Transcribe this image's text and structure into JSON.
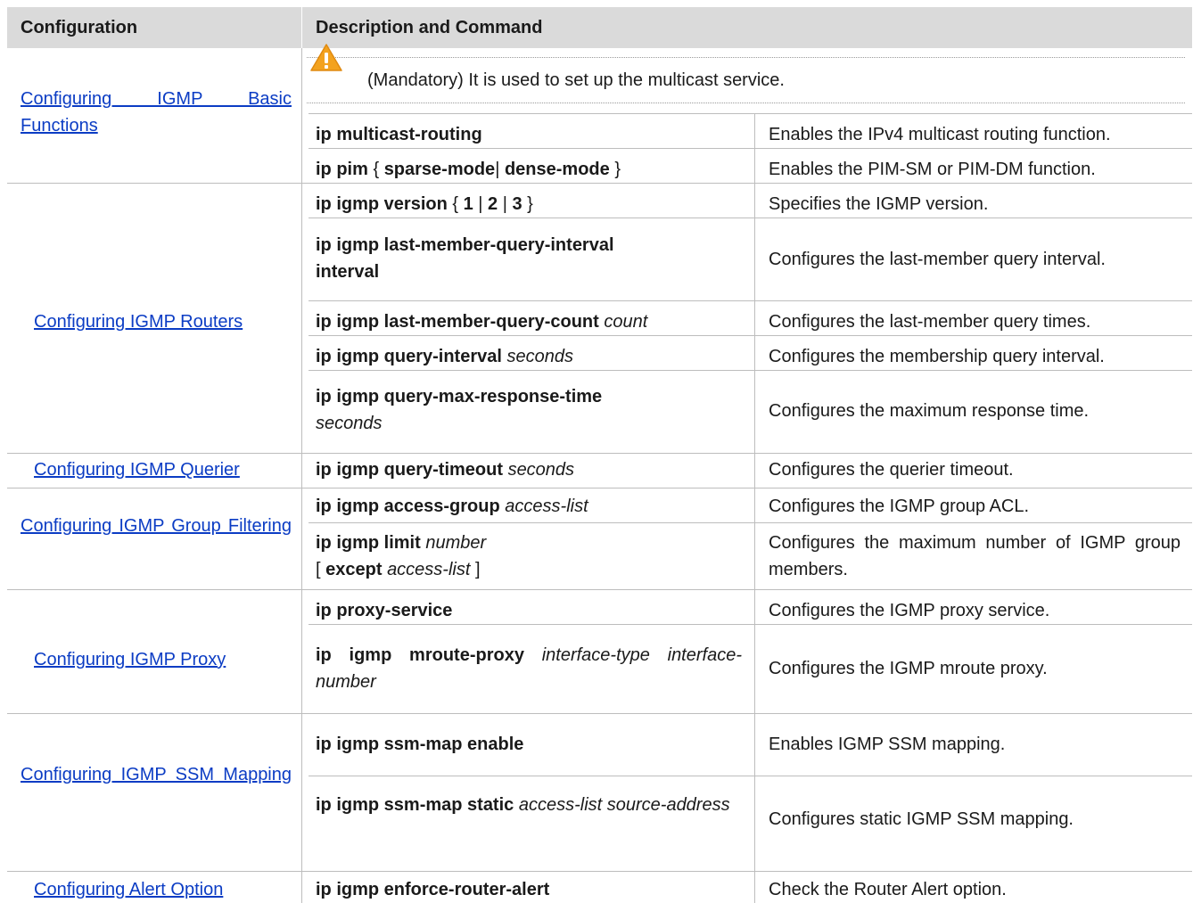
{
  "header": {
    "col_configuration": "Configuration",
    "col_description": "Description and Command"
  },
  "groups": {
    "basic": {
      "link": "Configuring IGMP Basic Functions",
      "note": "(Mandatory) It is used to set up the multicast service.",
      "rows": [
        {
          "cmd_b1": "ip multicast-routing",
          "desc": "Enables the IPv4 multicast routing function."
        },
        {
          "cmd_b1": "ip pim",
          "cmd_t1": " { ",
          "cmd_b2": "sparse-mode",
          "cmd_t2": "| ",
          "cmd_b3": "dense-mode",
          "cmd_t3": " }",
          "desc": "Enables the PIM-SM or PIM-DM function."
        }
      ]
    },
    "routers": {
      "link": "Configuring IGMP Routers",
      "rows": [
        {
          "cmd_b1": "ip igmp version",
          "cmd_t1": " { ",
          "cmd_b2": "1",
          "cmd_t2": " | ",
          "cmd_b3": "2",
          "cmd_t3": " | ",
          "cmd_b4": "3",
          "cmd_t4": " }",
          "desc": "Specifies the IGMP version."
        },
        {
          "cmd_b1": "ip igmp last-member-query-interval",
          "cmd_b2": "interval",
          "desc": "Configures the last-member query interval."
        },
        {
          "cmd_b1": "ip igmp last-member-query-count",
          "cmd_i1": "count",
          "desc": "Configures the last-member query times."
        },
        {
          "cmd_b1": "ip igmp query-interval",
          "cmd_i1": "seconds",
          "desc": "Configures the membership query interval."
        },
        {
          "cmd_b1": "ip igmp query-max-response-time",
          "cmd_i1": "seconds",
          "desc": "Configures the maximum response time."
        }
      ]
    },
    "querier": {
      "link": "Configuring IGMP Querier",
      "rows": [
        {
          "cmd_b1": "ip igmp query-timeout",
          "cmd_i1": "seconds",
          "desc": "Configures the querier timeout."
        }
      ]
    },
    "filtering": {
      "link": "Configuring IGMP Group Filtering",
      "rows": [
        {
          "cmd_b1": "ip igmp access-group",
          "cmd_i1": "access-list",
          "desc": "Configures the IGMP group ACL."
        },
        {
          "cmd_b1": "ip igmp limit",
          "cmd_i1": "number",
          "cmd_t1": "[ ",
          "cmd_b2": "except",
          "cmd_i2": "access-list",
          "cmd_t2": " ]",
          "desc": "Configures the maximum number of IGMP group members."
        }
      ]
    },
    "proxy": {
      "link": "Configuring IGMP Proxy",
      "rows": [
        {
          "cmd_b1": "ip proxy-service",
          "desc": "Configures the IGMP proxy service."
        },
        {
          "cmd_b1": "ip igmp mroute-proxy",
          "cmd_i1": "interface-type interface-number",
          "desc": "Configures the IGMP mroute proxy."
        }
      ]
    },
    "ssm": {
      "link": "Configuring IGMP SSM Mapping",
      "rows": [
        {
          "cmd_b1": "ip igmp ssm-map enable",
          "desc": "Enables IGMP SSM mapping."
        },
        {
          "cmd_b1": "ip igmp ssm-map static",
          "cmd_i1": "access-list source-address",
          "desc": "Configures static IGMP SSM mapping."
        }
      ]
    },
    "alert": {
      "link": "Configuring Alert Option",
      "rows": [
        {
          "cmd_b1": "ip igmp enforce-router-alert",
          "desc": "Check the Router Alert option."
        }
      ]
    }
  },
  "colors": {
    "header_bg": "#dadada",
    "link": "#0b3cc4",
    "grid": "#bdbdbd",
    "warn": "#f0a020"
  },
  "icons": {
    "note": "warning-triangle-icon"
  }
}
